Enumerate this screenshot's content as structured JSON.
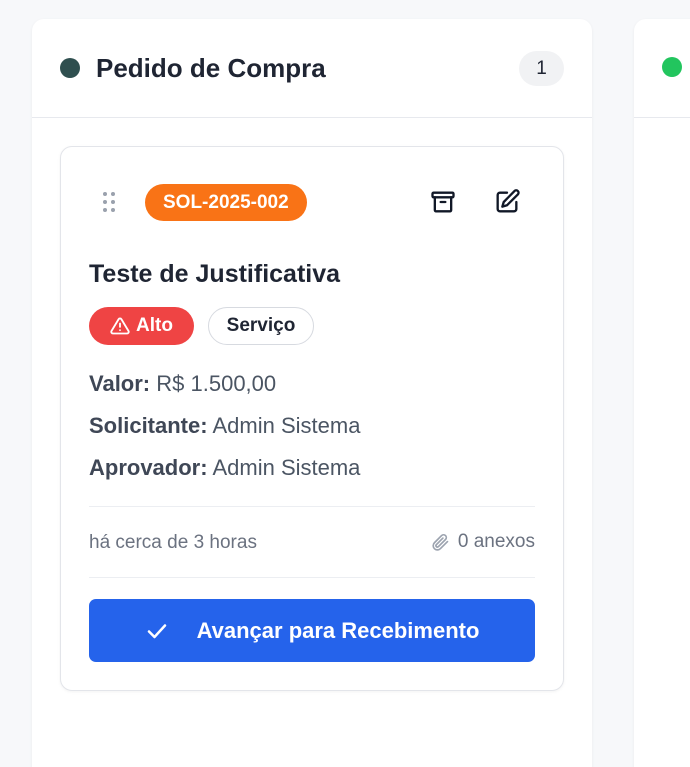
{
  "column": {
    "title": "Pedido de Compra",
    "count": "1",
    "dot_color": "#2f4f4f"
  },
  "next_column": {
    "dot_color": "#22c55e"
  },
  "card": {
    "code": "SOL-2025-002",
    "title": "Teste de Justificativa",
    "priority": {
      "label": "Alto",
      "icon": "warning-icon",
      "color": "#ef4444"
    },
    "type": "Serviço",
    "fields": [
      {
        "label": "Valor:",
        "value": "R$ 1.500,00"
      },
      {
        "label": "Solicitante:",
        "value": "Admin Sistema"
      },
      {
        "label": "Aprovador:",
        "value": "Admin Sistema"
      }
    ],
    "time_ago": "há cerca de 3 horas",
    "attachments": "0 anexos",
    "action_label": "Avançar para Recebimento",
    "icons": [
      "drag-handle-icon",
      "archive-icon",
      "edit-icon",
      "paperclip-icon",
      "check-icon"
    ]
  },
  "colors": {
    "code_badge": "#f97316",
    "action_button": "#2563eb"
  }
}
